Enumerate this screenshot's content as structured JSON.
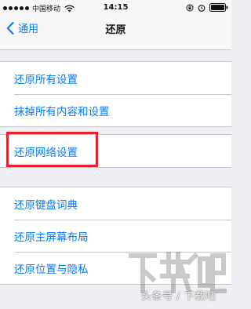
{
  "status_bar": {
    "carrier": "中国移动",
    "time": "14:15",
    "icons": [
      "signal-dots",
      "wifi-icon",
      "lock-rotation-icon",
      "alarm-icon",
      "battery-icon"
    ]
  },
  "nav": {
    "back_label": "通用",
    "title": "还原"
  },
  "groups": [
    {
      "items": [
        "还原所有设置",
        "抹掉所有内容和设置"
      ]
    },
    {
      "items": [
        "还原网络设置"
      ]
    },
    {
      "items": [
        "还原键盘词典",
        "还原主屏幕布局",
        "还原位置与隐私"
      ]
    }
  ],
  "watermark": {
    "text": "头条号 / 下载吧"
  },
  "colors": {
    "accent": "#007aff",
    "highlight": "#e8212d",
    "background": "#efeff4"
  }
}
